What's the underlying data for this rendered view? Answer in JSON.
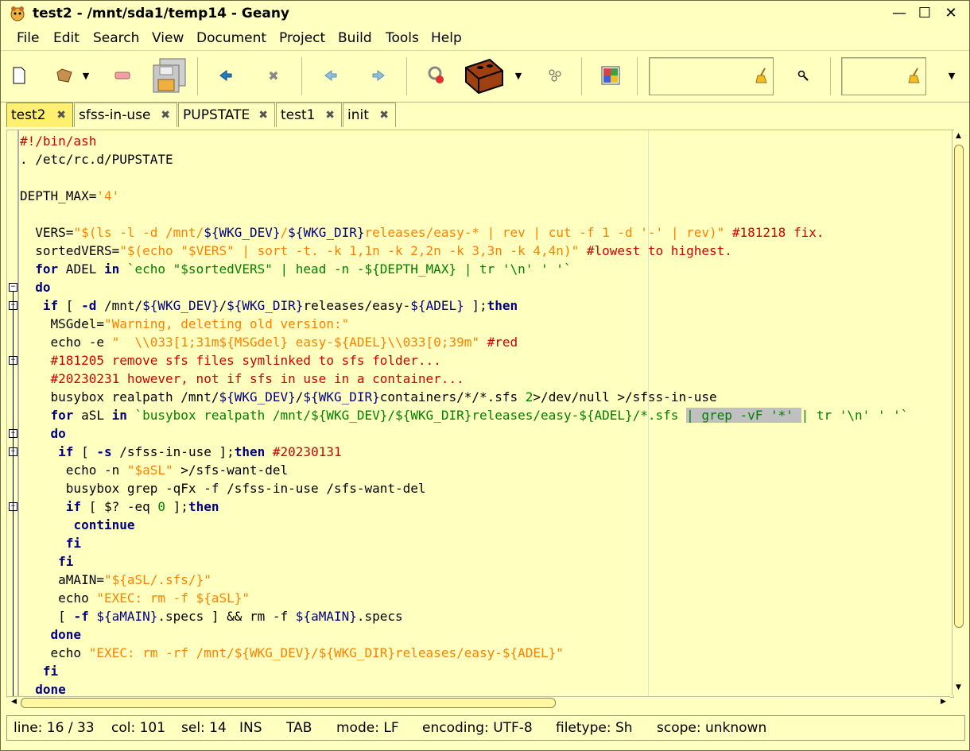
{
  "window": {
    "title": "test2 - /mnt/sda1/temp14 - Geany",
    "minimize_glyph": "—",
    "maximize_glyph": "☐",
    "close_glyph": "✕"
  },
  "menu": [
    "File",
    "Edit",
    "Search",
    "View",
    "Document",
    "Project",
    "Build",
    "Tools",
    "Help"
  ],
  "toolbar": {
    "icons": [
      "new-file-icon",
      "open-file-icon",
      "dropdown-icon",
      "save-icon",
      "save-all-icon",
      "back-icon",
      "close-icon",
      "nav-back-icon",
      "nav-forward-icon",
      "compile-icon",
      "build-icon",
      "dropdown-icon",
      "execute-icon",
      "color-chooser-icon",
      "clear-icon",
      "search-icon",
      "clear-icon",
      "dropdown-icon"
    ],
    "search_value": "",
    "goto_value": ""
  },
  "tabs": [
    {
      "label": "test2",
      "active": true
    },
    {
      "label": "sfss-in-use",
      "active": false
    },
    {
      "label": "PUPSTATE",
      "active": false
    },
    {
      "label": "test1",
      "active": false
    },
    {
      "label": "init",
      "active": false
    }
  ],
  "tab_close_glyph": "✖",
  "editor": {
    "lines": [
      [
        [
          "c-comment",
          "#!/bin/ash"
        ]
      ],
      [
        [
          "",
          ". /etc/rc.d/PUPSTATE"
        ]
      ],
      [
        [
          "",
          ""
        ]
      ],
      [
        [
          "",
          "DEPTH_MAX="
        ],
        [
          "c-str",
          "'4'"
        ]
      ],
      [
        [
          "",
          ""
        ]
      ],
      [
        [
          "",
          "  VERS="
        ],
        [
          "c-str",
          "\"$(ls -l -d /mnt/"
        ],
        [
          "c-var",
          "${WKG_DEV}"
        ],
        [
          "c-str",
          "/"
        ],
        [
          "c-var",
          "${WKG_DIR}"
        ],
        [
          "c-str",
          "releases/easy-* | rev | cut -f 1 -d '-' | rev)\""
        ],
        [
          "c-comment",
          " #181218 fix."
        ]
      ],
      [
        [
          "",
          "  sortedVERS="
        ],
        [
          "c-str",
          "\"$(echo \"$VERS\" | sort -t. -k 1,1n -k 2,2n -k 3,3n -k 4,4n)\""
        ],
        [
          "c-comment",
          " #lowest to highest."
        ]
      ],
      [
        [
          "",
          "  "
        ],
        [
          "c-kw",
          "for"
        ],
        [
          "",
          " ADEL "
        ],
        [
          "c-kw",
          "in"
        ],
        [
          "c-str2",
          " `echo \"$sortedVERS\" | head -n -${DEPTH_MAX} | tr '\\n' ' '`"
        ]
      ],
      [
        [
          "",
          "  "
        ],
        [
          "c-kw",
          "do"
        ]
      ],
      [
        [
          "",
          "   "
        ],
        [
          "c-kw",
          "if"
        ],
        [
          "",
          " [ "
        ],
        [
          "c-kw",
          "-d"
        ],
        [
          "",
          " /mnt/"
        ],
        [
          "c-var",
          "${WKG_DEV}"
        ],
        [
          "",
          "/"
        ],
        [
          "c-var",
          "${WKG_DIR}"
        ],
        [
          "",
          "releases/easy-"
        ],
        [
          "c-var",
          "${ADEL}"
        ],
        [
          "",
          " ];"
        ],
        [
          "c-kw",
          "then"
        ]
      ],
      [
        [
          "",
          "    MSGdel="
        ],
        [
          "c-str",
          "\"Warning, deleting old version:\""
        ]
      ],
      [
        [
          "",
          "    echo -e "
        ],
        [
          "c-str",
          "\"  \\\\033[1;31m${MSGdel} easy-${ADEL}\\\\033[0;39m\""
        ],
        [
          "c-comment",
          " #red"
        ]
      ],
      [
        [
          "",
          "    "
        ],
        [
          "c-comment",
          "#181205 remove sfs files symlinked to sfs folder..."
        ]
      ],
      [
        [
          "",
          "    "
        ],
        [
          "c-comment",
          "#20230231 however, not if sfs in use in a container..."
        ]
      ],
      [
        [
          "",
          "    busybox realpath /mnt/"
        ],
        [
          "c-var",
          "${WKG_DEV}"
        ],
        [
          "",
          "/"
        ],
        [
          "c-var",
          "${WKG_DIR}"
        ],
        [
          "",
          "containers/*/*.sfs "
        ],
        [
          "c-num",
          "2"
        ],
        [
          "",
          ">/dev/null >/sfss-in-use"
        ]
      ],
      [
        [
          "",
          "    "
        ],
        [
          "c-kw",
          "for"
        ],
        [
          "",
          " aSL "
        ],
        [
          "c-kw",
          "in"
        ],
        [
          "c-str2",
          " `busybox realpath /mnt/${WKG_DEV}/${WKG_DIR}releases/easy-${ADEL}/*.sfs "
        ],
        [
          "sel c-str2",
          "| grep -vF '*' "
        ],
        [
          "c-str2",
          "| tr '\\n' ' '`"
        ]
      ],
      [
        [
          "",
          "    "
        ],
        [
          "c-kw",
          "do"
        ]
      ],
      [
        [
          "",
          "     "
        ],
        [
          "c-kw",
          "if"
        ],
        [
          "",
          " [ "
        ],
        [
          "c-kw",
          "-s"
        ],
        [
          "",
          " /sfss-in-use ];"
        ],
        [
          "c-kw",
          "then"
        ],
        [
          "c-comment",
          " #20230131"
        ]
      ],
      [
        [
          "",
          "      echo -n "
        ],
        [
          "c-str",
          "\"$aSL\""
        ],
        [
          "",
          " >/sfs-want-del"
        ]
      ],
      [
        [
          "",
          "      busybox grep -qFx -f /sfss-in-use /sfs-want-del"
        ]
      ],
      [
        [
          "",
          "      "
        ],
        [
          "c-kw",
          "if"
        ],
        [
          "",
          " [ $? -eq "
        ],
        [
          "c-num",
          "0"
        ],
        [
          "",
          " ];"
        ],
        [
          "c-kw",
          "then"
        ]
      ],
      [
        [
          "",
          "       "
        ],
        [
          "c-kw",
          "continue"
        ]
      ],
      [
        [
          "",
          "      "
        ],
        [
          "c-kw",
          "fi"
        ]
      ],
      [
        [
          "",
          "     "
        ],
        [
          "c-kw",
          "fi"
        ]
      ],
      [
        [
          "",
          "     aMAIN="
        ],
        [
          "c-str",
          "\"${aSL/.sfs/}\""
        ]
      ],
      [
        [
          "",
          "     echo "
        ],
        [
          "c-str",
          "\"EXEC: rm -f ${aSL}\""
        ]
      ],
      [
        [
          "",
          "     [ "
        ],
        [
          "c-kw",
          "-f"
        ],
        [
          "",
          " "
        ],
        [
          "c-var",
          "${aMAIN}"
        ],
        [
          "",
          ".specs ] && rm -f "
        ],
        [
          "c-var",
          "${aMAIN}"
        ],
        [
          "",
          ".specs"
        ]
      ],
      [
        [
          "",
          "    "
        ],
        [
          "c-kw",
          "done"
        ]
      ],
      [
        [
          "",
          "    echo "
        ],
        [
          "c-str",
          "\"EXEC: rm -rf /mnt/${WKG_DEV}/${WKG_DIR}releases/easy-${ADEL}\""
        ]
      ],
      [
        [
          "",
          "   "
        ],
        [
          "c-kw",
          "fi"
        ]
      ],
      [
        [
          "",
          "  "
        ],
        [
          "c-kw",
          "done"
        ]
      ]
    ]
  },
  "status": {
    "line": "line: 16 / 33",
    "col": "col: 101",
    "sel": "sel: 14",
    "ins": "INS",
    "tab": "TAB",
    "mode": "mode: LF",
    "encoding": "encoding: UTF-8",
    "filetype": "filetype: Sh",
    "scope": "scope: unknown"
  }
}
